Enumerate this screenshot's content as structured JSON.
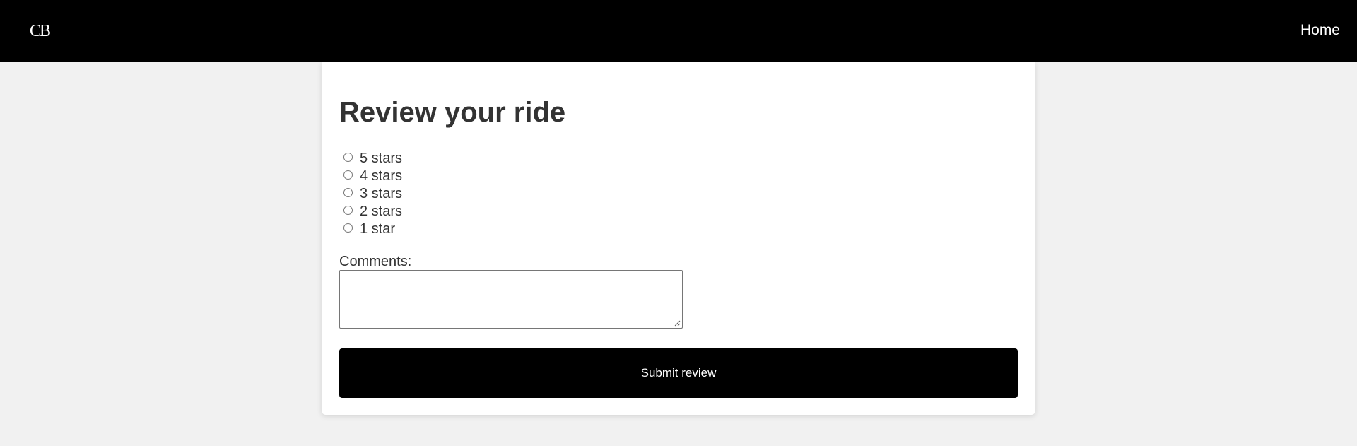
{
  "header": {
    "logo": "CB",
    "nav_home": "Home"
  },
  "review": {
    "title": "Review your ride",
    "ratings": [
      {
        "label": "5 stars",
        "selected": false
      },
      {
        "label": "4 stars",
        "selected": false
      },
      {
        "label": "3 stars",
        "selected": false
      },
      {
        "label": "2 stars",
        "selected": false
      },
      {
        "label": "1 star",
        "selected": false
      }
    ],
    "comments_label": "Comments:",
    "comments_value": "",
    "submit_label": "Submit review"
  },
  "colors": {
    "header_bg": "#000000",
    "page_bg": "#f1f1f1",
    "card_bg": "#ffffff",
    "button_bg": "#000000",
    "text": "#333333"
  }
}
